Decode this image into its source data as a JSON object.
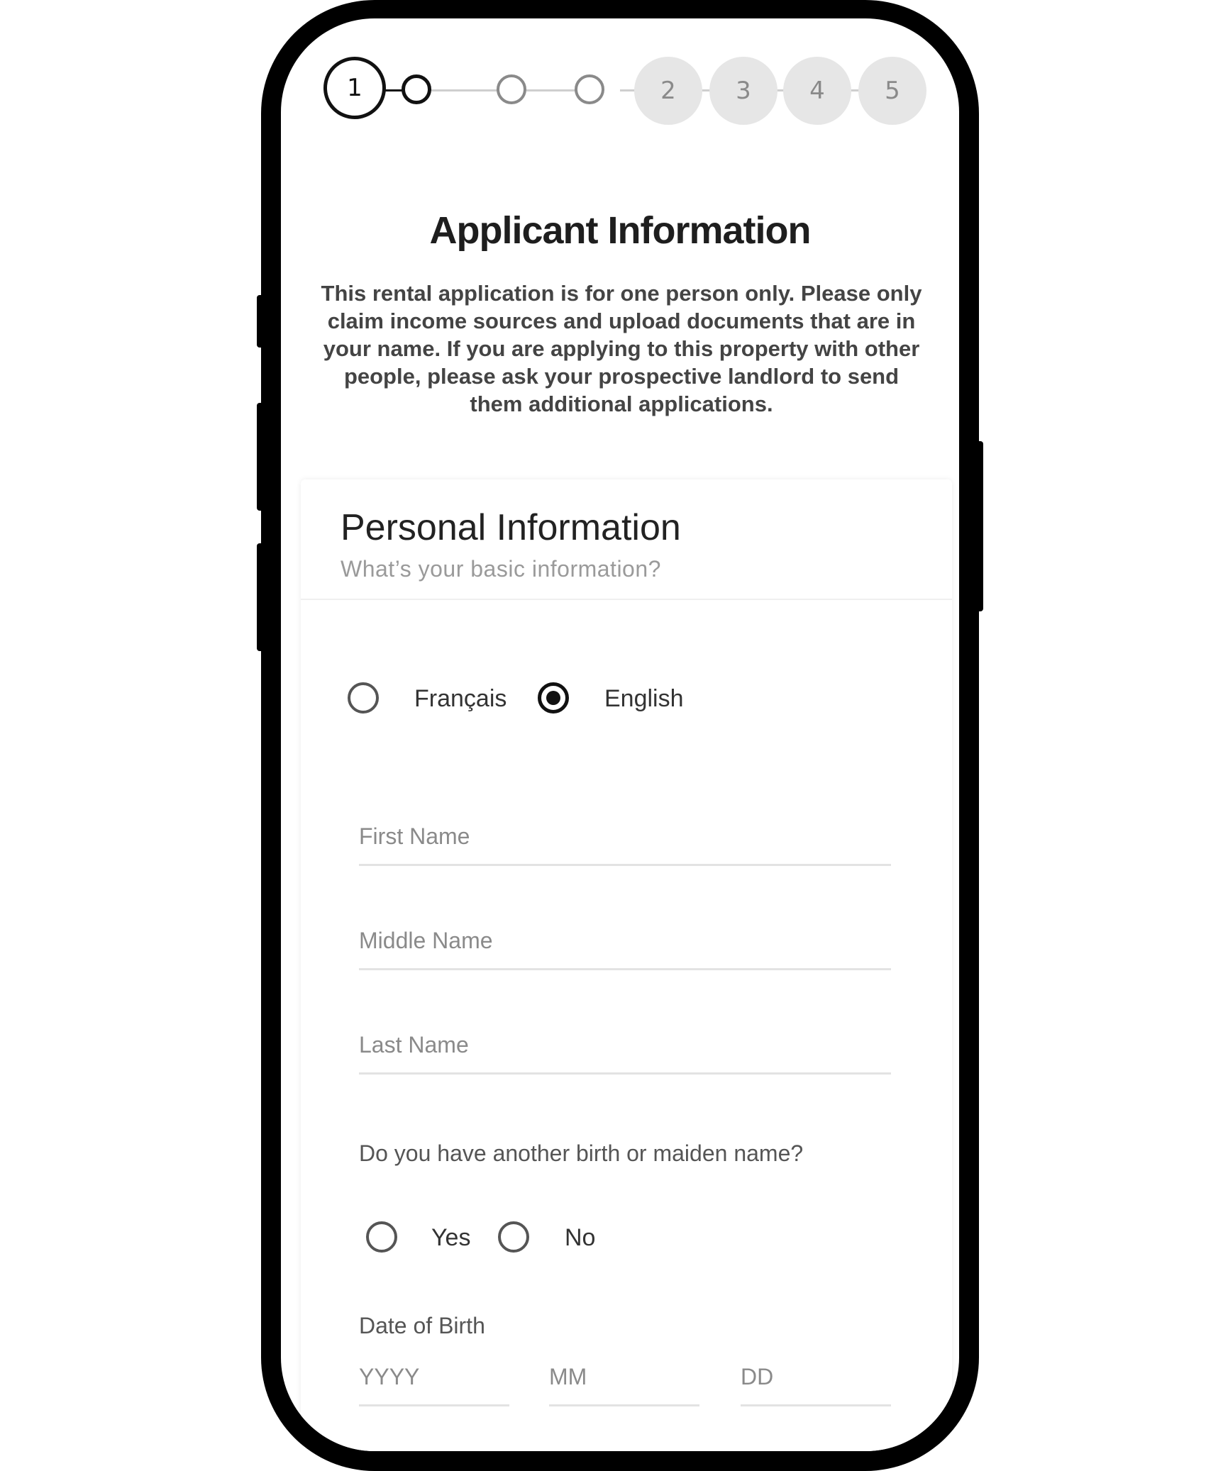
{
  "stepper": {
    "active_step": "1",
    "steps": [
      "2",
      "3",
      "4",
      "5"
    ]
  },
  "page": {
    "title": "Applicant Information",
    "intro": "This rental application is for one person only. Please only claim income sources and upload documents that are in your name. If you are applying to this property with other people, please ask your prospective landlord to send them additional applications."
  },
  "card": {
    "title": "Personal Information",
    "subtitle": "What’s your basic information?"
  },
  "language": {
    "options": [
      "Français",
      "English"
    ],
    "selected": "English"
  },
  "fields": {
    "first_name_placeholder": "First Name",
    "middle_name_placeholder": "Middle Name",
    "last_name_placeholder": "Last Name"
  },
  "other_name": {
    "question": "Do you have another birth or maiden name?",
    "options": [
      "Yes",
      "No"
    ],
    "selected": null
  },
  "dob": {
    "label": "Date of Birth",
    "year_placeholder": "YYYY",
    "month_placeholder": "MM",
    "day_placeholder": "DD"
  },
  "colors": {
    "frame": "#000000",
    "accent": "#111111",
    "inactive_step_bg": "#e6e6e6",
    "inactive_step_text": "#8a8a8a",
    "placeholder": "#8a8a8a"
  }
}
